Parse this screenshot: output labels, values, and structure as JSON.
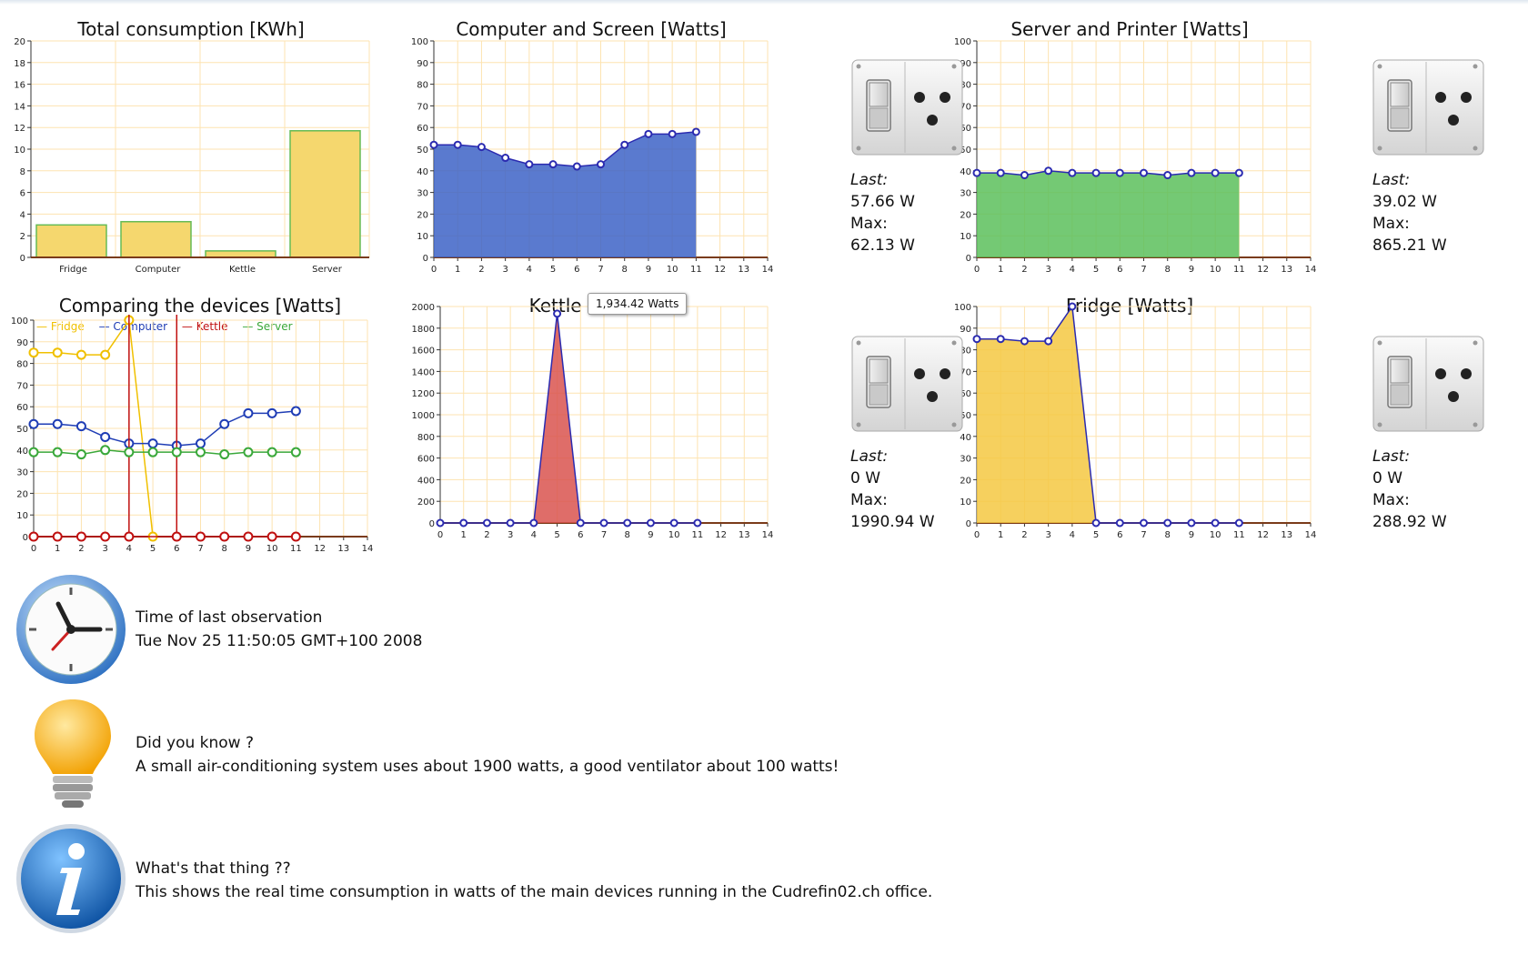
{
  "charts": {
    "total": {
      "title": "Total consumption [KWh]",
      "chart_data": {
        "type": "bar",
        "categories": [
          "Fridge",
          "Computer",
          "Kettle",
          "Server"
        ],
        "values": [
          3.0,
          3.3,
          0.6,
          11.7
        ],
        "ylim": [
          0,
          20
        ],
        "yticks": [
          0,
          2,
          4,
          6,
          8,
          10,
          12,
          14,
          16,
          18,
          20
        ],
        "color": "#f5d76e"
      }
    },
    "computer": {
      "title": "Computer and Screen [Watts]",
      "chart_data": {
        "type": "area",
        "x": [
          0,
          1,
          2,
          3,
          4,
          5,
          6,
          7,
          8,
          9,
          10,
          11
        ],
        "values": [
          52,
          52,
          51,
          46,
          43,
          43,
          42,
          43,
          52,
          57,
          57,
          58
        ],
        "xlim": [
          0,
          14
        ],
        "ylim": [
          0,
          100
        ],
        "color": "#3d63c7"
      }
    },
    "server": {
      "title": "Server and Printer [Watts]",
      "chart_data": {
        "type": "area",
        "x": [
          0,
          1,
          2,
          3,
          4,
          5,
          6,
          7,
          8,
          9,
          10,
          11
        ],
        "values": [
          39,
          39,
          38,
          40,
          39,
          39,
          39,
          39,
          38,
          39,
          39,
          39
        ],
        "xlim": [
          0,
          14
        ],
        "ylim": [
          0,
          100
        ],
        "color": "#5cbf5c"
      }
    },
    "compare": {
      "title": "Comparing the devices [Watts]",
      "chart_data": {
        "type": "line",
        "x": [
          0,
          1,
          2,
          3,
          4,
          5,
          6,
          7,
          8,
          9,
          10,
          11
        ],
        "xlim": [
          0,
          14
        ],
        "ylim": [
          0,
          100
        ],
        "series": [
          {
            "name": "Fridge",
            "color": "#f0c000",
            "values": [
              85,
              85,
              84,
              84,
              100,
              0,
              null,
              null,
              null,
              null,
              null,
              null
            ]
          },
          {
            "name": "Computer",
            "color": "#1f3db5",
            "values": [
              52,
              52,
              51,
              46,
              43,
              43,
              42,
              43,
              52,
              57,
              57,
              58
            ]
          },
          {
            "name": "Kettle",
            "color": "#c01010",
            "values": [
              0,
              0,
              0,
              0,
              0,
              1934,
              0,
              0,
              0,
              0,
              0,
              0
            ]
          },
          {
            "name": "Server",
            "color": "#3aa83a",
            "values": [
              39,
              39,
              38,
              40,
              39,
              39,
              39,
              39,
              38,
              39,
              39,
              39
            ]
          }
        ]
      }
    },
    "kettle": {
      "title": "Kettle [Watts]",
      "tooltip": "1,934.42 Watts",
      "chart_data": {
        "type": "area",
        "x": [
          0,
          1,
          2,
          3,
          4,
          5,
          6,
          7,
          8,
          9,
          10,
          11
        ],
        "values": [
          0,
          0,
          0,
          0,
          0,
          1934,
          0,
          0,
          0,
          0,
          0,
          0
        ],
        "xlim": [
          0,
          14
        ],
        "ylim": [
          0,
          2000
        ],
        "yticks": [
          0,
          200,
          400,
          600,
          800,
          1000,
          1200,
          1400,
          1600,
          1800,
          2000
        ],
        "color": "#d9534f"
      }
    },
    "fridge": {
      "title": "Fridge [Watts]",
      "chart_data": {
        "type": "area",
        "x": [
          0,
          1,
          2,
          3,
          4,
          5,
          6,
          7,
          8,
          9,
          10,
          11
        ],
        "values": [
          85,
          85,
          84,
          84,
          100,
          0,
          0,
          0,
          0,
          0,
          0,
          0
        ],
        "xlim": [
          0,
          14
        ],
        "ylim": [
          0,
          100
        ],
        "color": "#f5c842"
      }
    }
  },
  "stats": {
    "computer": {
      "last_label": "Last:",
      "last": "57.66 W",
      "max_label": "Max:",
      "max": "62.13 W"
    },
    "server": {
      "last_label": "Last:",
      "last": "39.02 W",
      "max_label": "Max:",
      "max": "865.21 W"
    },
    "kettle": {
      "last_label": "Last:",
      "last": "0 W",
      "max_label": "Max:",
      "max": "1990.94 W"
    },
    "fridge": {
      "last_label": "Last:",
      "last": "0 W",
      "max_label": "Max:",
      "max": "288.92 W"
    }
  },
  "info": {
    "time_label": "Time of last observation",
    "time_value": "Tue Nov 25 11:50:05 GMT+100 2008",
    "tip_label": "Did you know ?",
    "tip_text": "A small air-conditioning system uses about 1900 watts, a good ventilator about 100 watts!",
    "about_label": "What's that thing ??",
    "about_text": "This shows the real time consumption in watts of the main devices running in the Cudrefin02.ch office."
  },
  "icons": {
    "clock": "clock-icon",
    "bulb": "lightbulb-icon",
    "info": "info-icon",
    "switch": "power-switch-icon"
  }
}
